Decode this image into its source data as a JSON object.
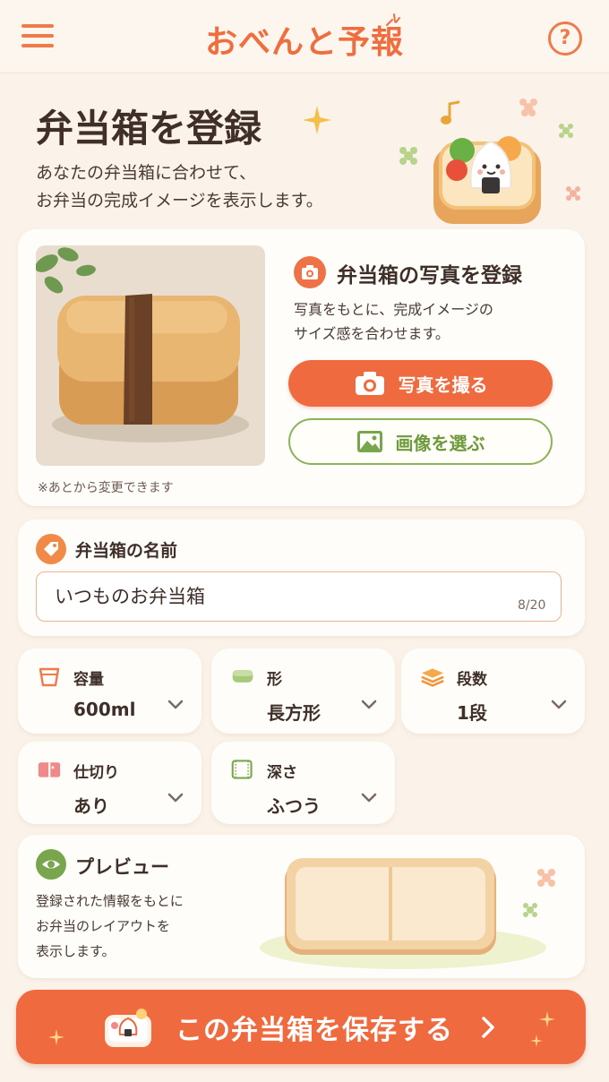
{
  "app": {
    "title": "おべんと予報"
  },
  "header": {
    "menu_icon": "hamburger-icon",
    "help_icon": "help-icon",
    "help_label": "?"
  },
  "page": {
    "title": "弁当箱を登録",
    "description_line1": "あなたの弁当箱に合わせて、",
    "description_line2": "お弁当の完成イメージを表示します。"
  },
  "photo_section": {
    "heading": "弁当箱の写真を登録",
    "description_line1": "写真をもとに、完成イメージの",
    "description_line2": "サイズ感を合わせます。",
    "take_photo_label": "写真を撮る",
    "choose_image_label": "画像を選ぶ",
    "note": "※あとから変更できます"
  },
  "name_section": {
    "label": "弁当箱の名前",
    "value": "いつものお弁当箱",
    "count": "8/20"
  },
  "options": [
    {
      "label": "容量",
      "value": "600ml",
      "icon": "cup-icon"
    },
    {
      "label": "形",
      "value": "長方形",
      "icon": "shape-icon"
    },
    {
      "label": "段数",
      "value": "1段",
      "icon": "layers-icon"
    },
    {
      "label": "仕切り",
      "value": "あり",
      "icon": "divider-icon"
    },
    {
      "label": "深さ",
      "value": "ふつう",
      "icon": "depth-icon"
    }
  ],
  "preview": {
    "label": "プレビュー",
    "description_line1": "登録された情報をもとに",
    "description_line2": "お弁当のレイアウトを",
    "description_line3": "表示します。"
  },
  "save_button": {
    "label": "この弁当箱を保存する"
  },
  "colors": {
    "accent": "#ef6a3e",
    "green": "#79a54d",
    "background": "#fbf3ea",
    "card": "#fffdfa",
    "text": "#3f2f28"
  }
}
